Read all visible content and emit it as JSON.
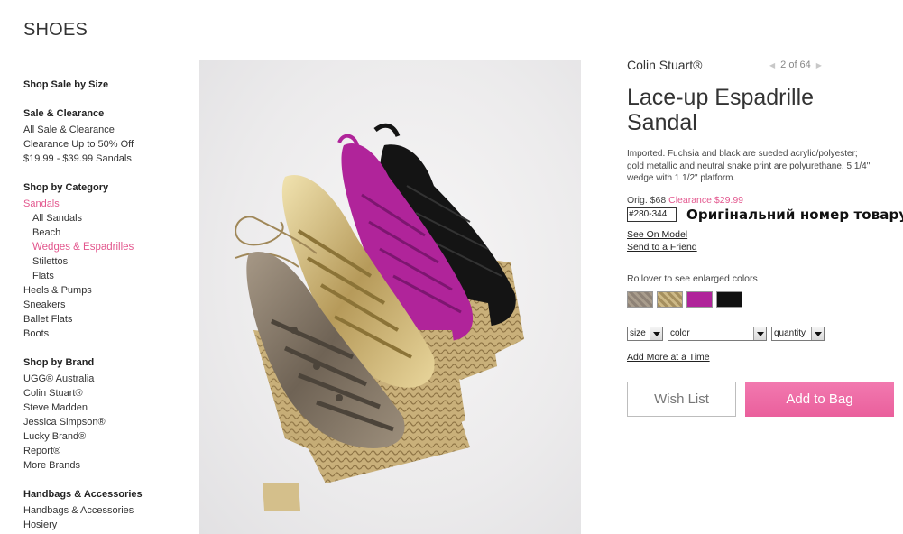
{
  "page": {
    "title": "SHOES"
  },
  "sidebar": {
    "sale_by_size": {
      "heading": "Shop Sale by Size"
    },
    "sale": {
      "heading": "Sale & Clearance",
      "links": [
        "All Sale & Clearance",
        "Clearance Up to 50% Off",
        "$19.99 - $39.99 Sandals"
      ]
    },
    "category": {
      "heading": "Shop by Category",
      "sandals": "Sandals",
      "sandal_subs": [
        "All Sandals",
        "Beach",
        "Wedges & Espadrilles",
        "Stilettos",
        "Flats"
      ],
      "others": [
        "Heels & Pumps",
        "Sneakers",
        "Ballet Flats",
        "Boots"
      ]
    },
    "brand": {
      "heading": "Shop by Brand",
      "links": [
        "UGG® Australia",
        "Colin Stuart®",
        "Steve Madden",
        "Jessica Simpson®",
        "Lucky Brand®",
        "Report®",
        "More Brands"
      ]
    },
    "handbags": {
      "heading": "Handbags & Accessories",
      "links": [
        "Handbags & Accessories",
        "Hosiery"
      ]
    }
  },
  "product": {
    "brand": "Colin Stuart®",
    "pager": {
      "text": "2 of 64"
    },
    "name": "Lace-up Espadrille Sandal",
    "description": "Imported. Fuchsia and black are sueded acrylic/polyester; gold metallic and neutral snake print are polyurethane. 5 1/4\" wedge with 1 1/2\" platform.",
    "price": {
      "orig": "Orig. $68",
      "clearance": "Clearance $29.99"
    },
    "item_number": "#280-344",
    "item_note": "Оригінальний номер товару",
    "see_on_model": "See On Model",
    "send_to_friend": "Send to a Friend",
    "rollover_text": "Rollover to see enlarged colors",
    "swatches": [
      {
        "name": "snake-print",
        "color": "#8e8276"
      },
      {
        "name": "gold",
        "color": "#b8a374"
      },
      {
        "name": "fuchsia",
        "color": "#b0249a"
      },
      {
        "name": "black",
        "color": "#111111"
      }
    ],
    "selects": {
      "size": "size",
      "color": "color",
      "quantity": "quantity"
    },
    "add_more": "Add More at a Time",
    "wish_list": "Wish List",
    "add_to_bag": "Add to Bag"
  }
}
